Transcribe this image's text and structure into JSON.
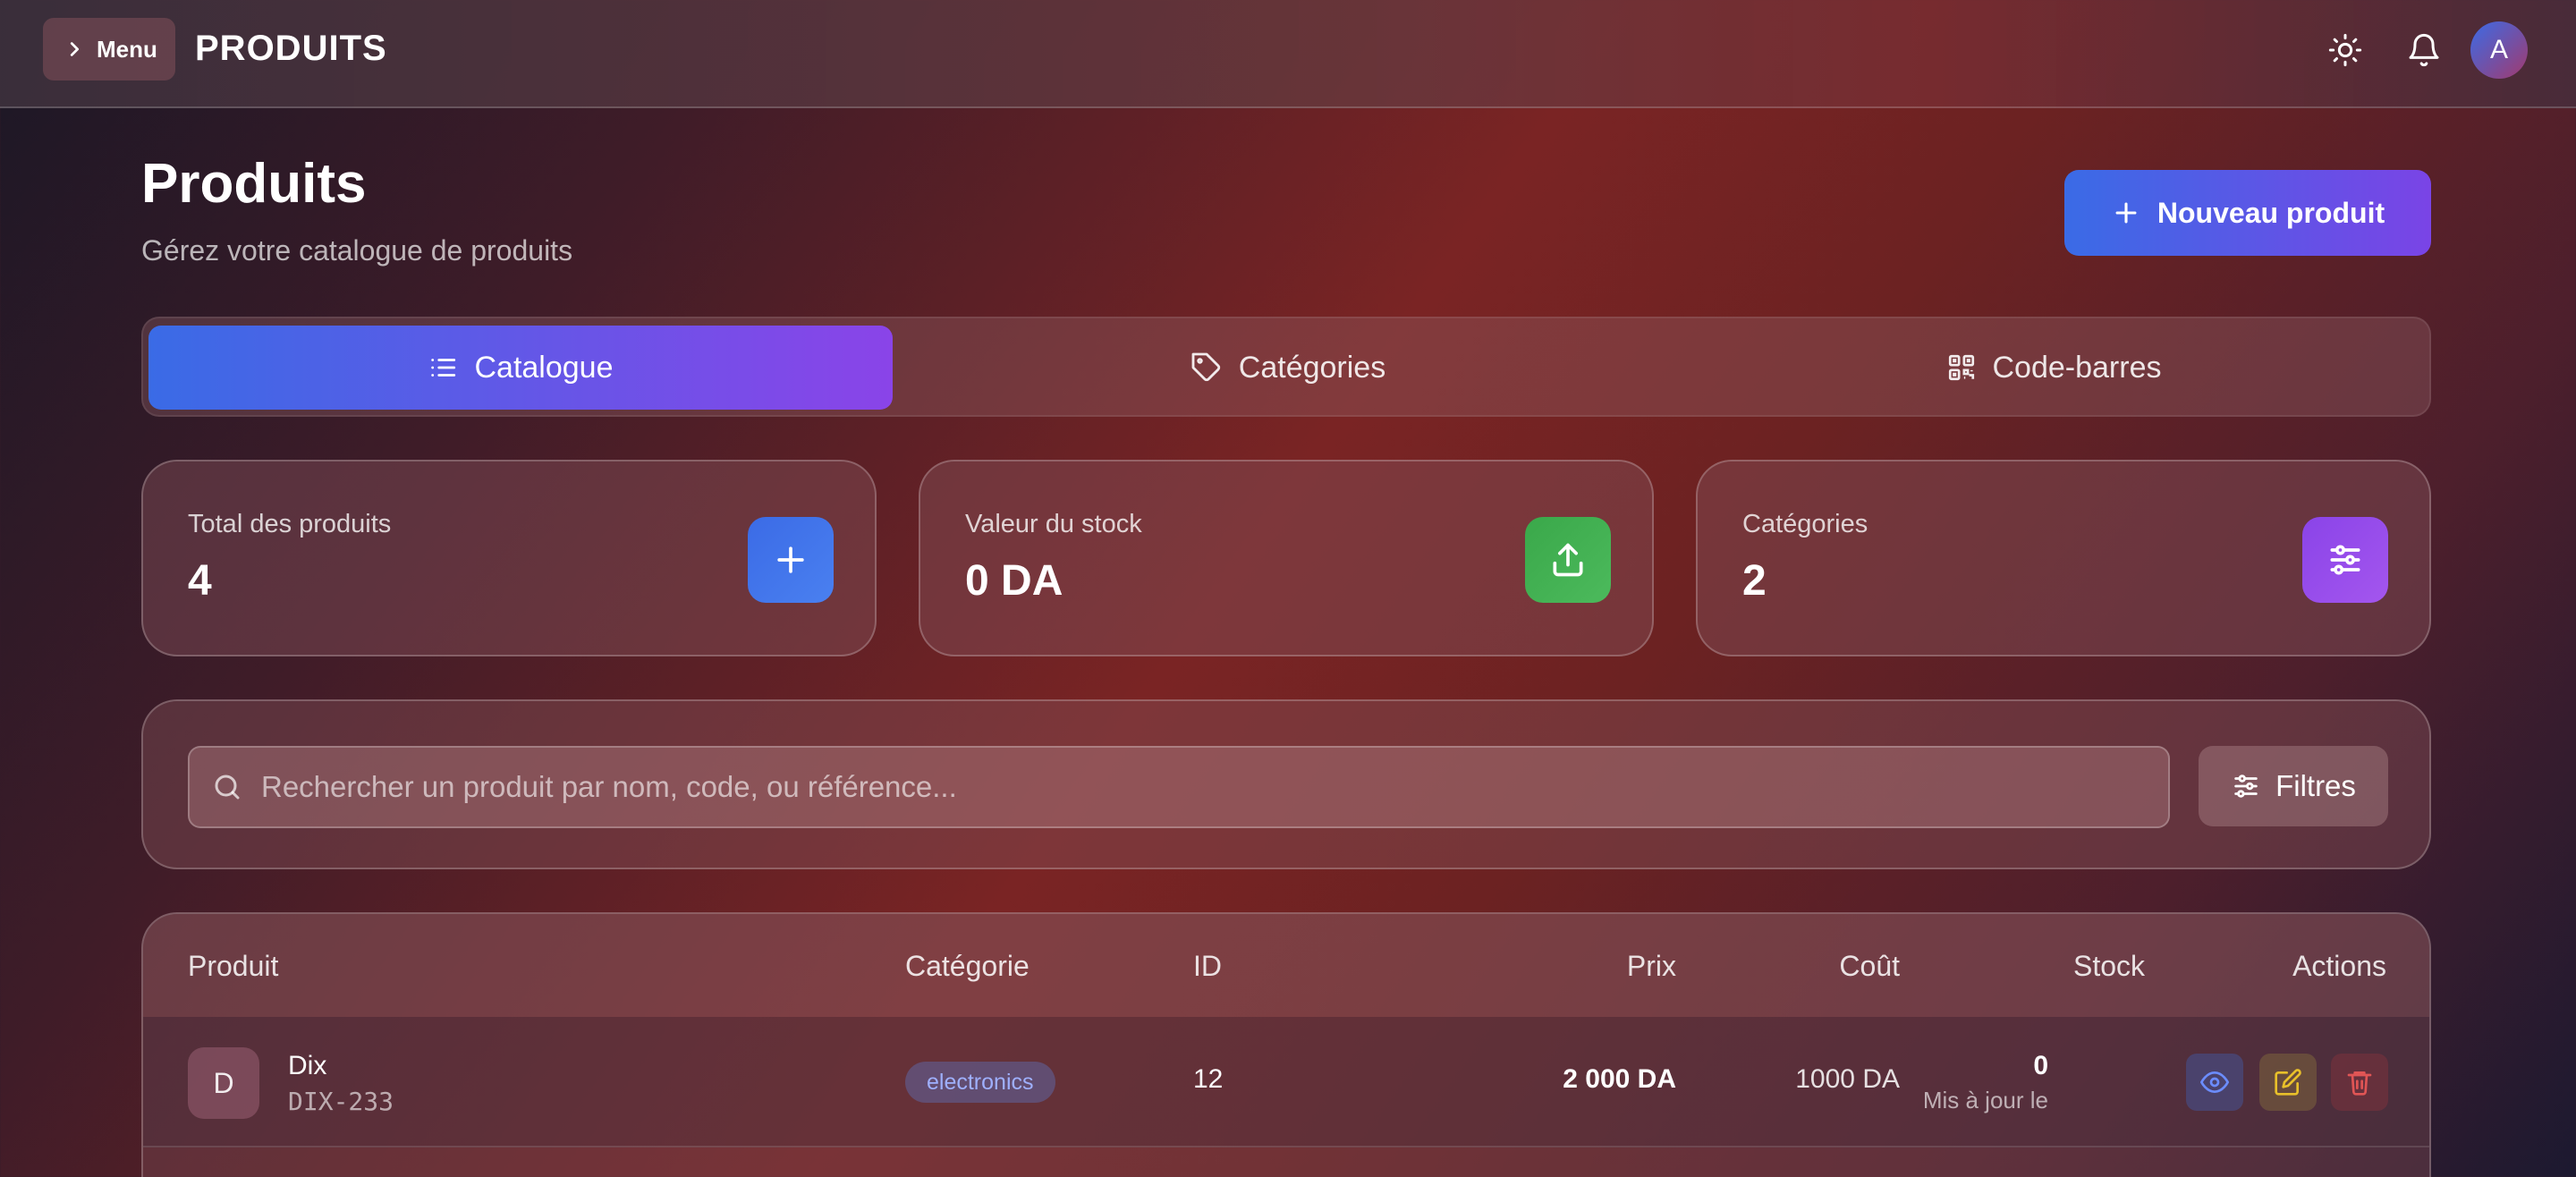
{
  "topbar": {
    "menu_label": "Menu",
    "app_title": "PRODUITS",
    "avatar_initial": "A"
  },
  "header": {
    "title": "Produits",
    "subtitle": "Gérez votre catalogue de produits",
    "new_button": "Nouveau produit"
  },
  "tabs": [
    {
      "label": "Catalogue",
      "icon": "list-icon",
      "active": true
    },
    {
      "label": "Catégories",
      "icon": "tag-icon",
      "active": false
    },
    {
      "label": "Code-barres",
      "icon": "qr-code-icon",
      "active": false
    }
  ],
  "stats": [
    {
      "label": "Total des produits",
      "value": "4",
      "icon": "plus-icon",
      "color": "#3b6be6"
    },
    {
      "label": "Valeur du stock",
      "value": "0 DA",
      "icon": "upload-icon",
      "color": "#3cab4e"
    },
    {
      "label": "Catégories",
      "value": "2",
      "icon": "sliders-icon",
      "color": "#9a4ee8"
    }
  ],
  "search": {
    "placeholder": "Rechercher un produit par nom, code, ou référence...",
    "filter_label": "Filtres"
  },
  "table": {
    "columns": [
      "Produit",
      "Catégorie",
      "ID",
      "Prix",
      "Coût",
      "Stock",
      "Actions"
    ],
    "rows": [
      {
        "initial": "D",
        "name": "Dix",
        "code": "DIX-233",
        "category": "electronics",
        "id": "12",
        "price": "2 000 DA",
        "cost": "1000 DA",
        "stock": "0",
        "stock_note": "Mis à jour le"
      }
    ]
  },
  "colors": {
    "accent_blue": "#3a6be6",
    "accent_purple": "#8a44e8",
    "view_action": "#6b8cff",
    "edit_action": "#e8c02a",
    "delete_action": "#e05555"
  }
}
